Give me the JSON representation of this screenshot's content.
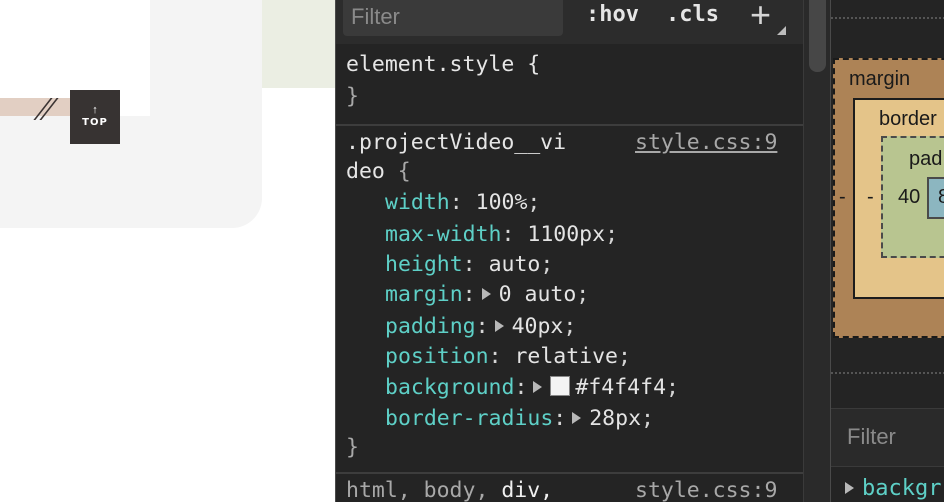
{
  "webpage": {
    "top_button": {
      "arrow": "↑",
      "label": "TOP"
    }
  },
  "styles_pane": {
    "filter_placeholder": "Filter",
    "hov_label": ":hov",
    "cls_label": ".cls",
    "new_rule_label": "+",
    "element_style": {
      "open": "element.style {",
      "close": "}"
    },
    "rule": {
      "selector_line1": ".projectVideo__vi",
      "selector_line2": "deo",
      "open_brace": "{",
      "close_brace": "}",
      "source": "style.css:9",
      "declarations": [
        {
          "prop": "width",
          "value": "100%",
          "expandable": false
        },
        {
          "prop": "max-width",
          "value": "1100px",
          "expandable": false
        },
        {
          "prop": "height",
          "value": "auto",
          "expandable": false
        },
        {
          "prop": "margin",
          "value": "0 auto",
          "expandable": true
        },
        {
          "prop": "padding",
          "value": "40px",
          "expandable": true
        },
        {
          "prop": "position",
          "value": "relative",
          "expandable": false
        },
        {
          "prop": "background",
          "value": "#f4f4f4",
          "expandable": true,
          "swatch": "#f4f4f4"
        },
        {
          "prop": "border-radius",
          "value": "28px",
          "expandable": true
        }
      ]
    },
    "breadcrumb": {
      "pre": "html, body, ",
      "current": "div,",
      "source": "style.css:9"
    }
  },
  "computed_pane": {
    "box_model": {
      "margin_label": "margin",
      "border_label": "border",
      "padding_label": "pad",
      "margin_left_value": "-",
      "border_left_value": "-",
      "padding_left_value": "40",
      "content_value": "8"
    },
    "filter_placeholder": "Filter",
    "first_property": "backgr"
  },
  "colors": {
    "devtools_bg": "#242424",
    "property_name": "#5ed0c7",
    "margin_box": "#ad8356",
    "border_box": "#e4c489",
    "padding_box": "#b8c590",
    "content_box": "#8cb6c0"
  }
}
